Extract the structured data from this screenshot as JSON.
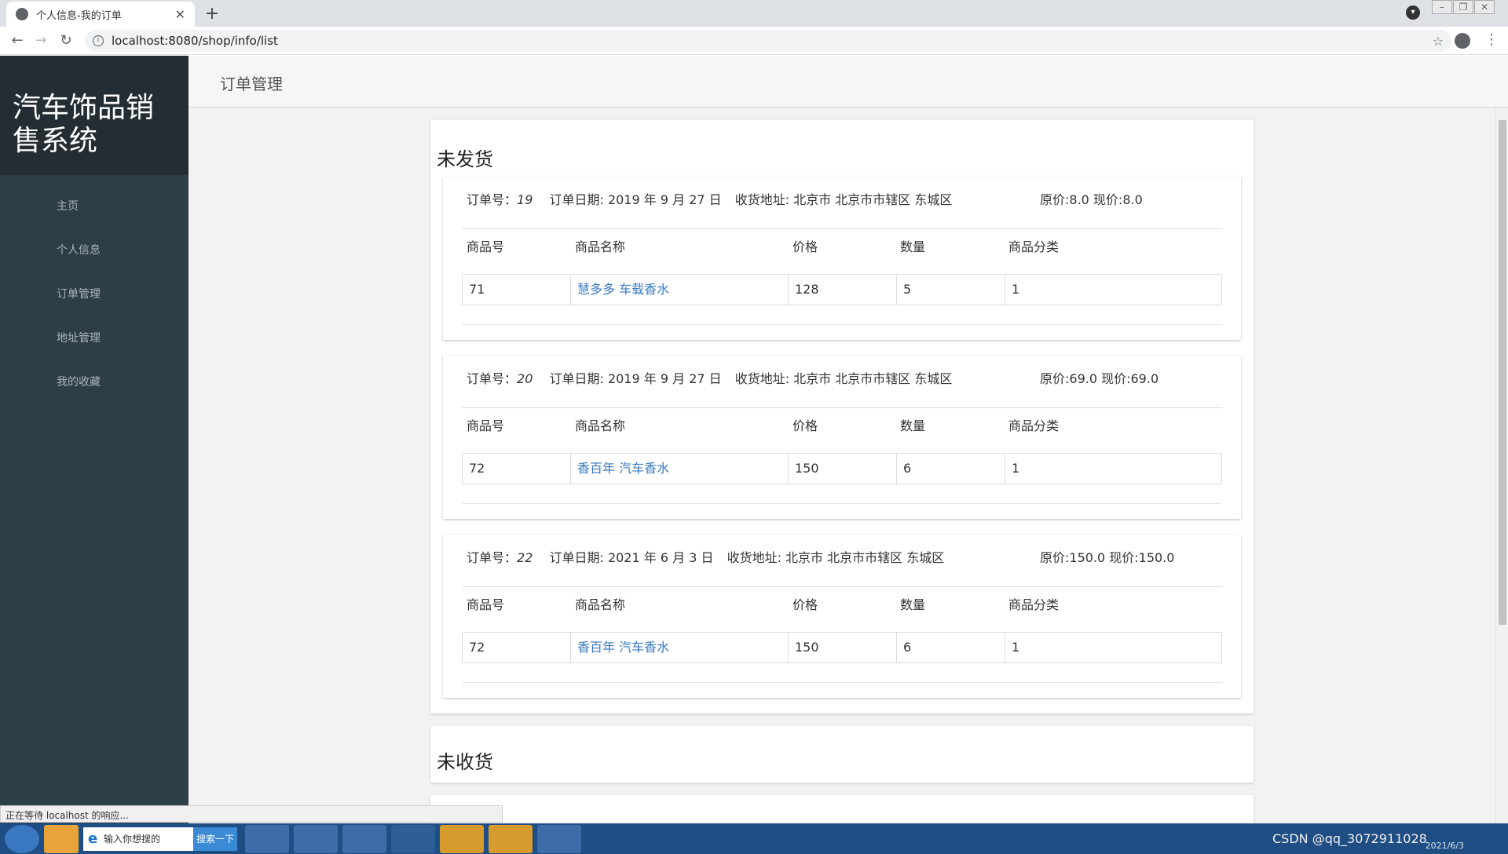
{
  "browser": {
    "tab_title": "个人信息-我的订单",
    "url": "localhost:8080/shop/info/list"
  },
  "sidebar": {
    "logo": "汽车饰品销售系统",
    "items": [
      {
        "label": "主页"
      },
      {
        "label": "个人信息"
      },
      {
        "label": "订单管理"
      },
      {
        "label": "地址管理"
      },
      {
        "label": "我的收藏"
      }
    ]
  },
  "header": {
    "title": "订单管理"
  },
  "sections": [
    {
      "title": "未发货",
      "orders": [
        {
          "label_no": "订单号：",
          "no": "19",
          "date": "订单日期: 2019 年 9 月 27 日",
          "address": "收货地址: 北京市 北京市市辖区 东城区",
          "price": "原价:8.0 现价:8.0",
          "headers": [
            "商品号",
            "商品名称",
            "价格",
            "数量",
            "商品分类"
          ],
          "row": [
            "71",
            "慧多多 车载香水",
            "128",
            "5",
            "1"
          ]
        },
        {
          "label_no": "订单号：",
          "no": "20",
          "date": "订单日期: 2019 年 9 月 27 日",
          "address": "收货地址: 北京市 北京市市辖区 东城区",
          "price": "原价:69.0 现价:69.0",
          "headers": [
            "商品号",
            "商品名称",
            "价格",
            "数量",
            "商品分类"
          ],
          "row": [
            "72",
            "香百年 汽车香水",
            "150",
            "6",
            "1"
          ]
        },
        {
          "label_no": "订单号：",
          "no": "22",
          "date": "订单日期: 2021 年 6 月 3 日",
          "address": "收货地址: 北京市 北京市市辖区 东城区",
          "price": "原价:150.0 现价:150.0",
          "headers": [
            "商品号",
            "商品名称",
            "价格",
            "数量",
            "商品分类"
          ],
          "row": [
            "72",
            "香百年 汽车香水",
            "150",
            "6",
            "1"
          ]
        }
      ]
    },
    {
      "title": "未收货"
    }
  ],
  "status_text": "正在等待 localhost 的响应...",
  "taskbar": {
    "search_placeholder": "输入你想搜的",
    "search_button": "搜索一下",
    "tray_watermark": "CSDN @qq_3072911028",
    "tray_date": "2021/6/3"
  }
}
